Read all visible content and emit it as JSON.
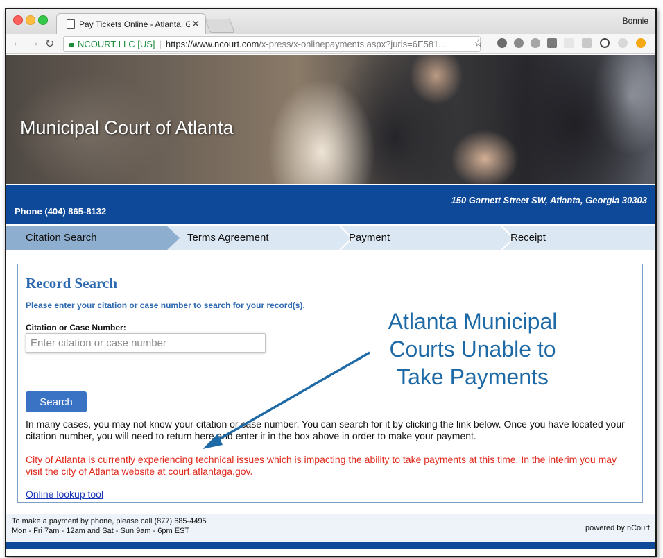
{
  "browser": {
    "tab_title": "Pay Tickets Online - Atlanta, G",
    "profile": "Bonnie",
    "cert_name": "NCOURT LLC [US]",
    "url_base": "https://www.ncourt.com",
    "url_path": "/x-press/x-onlinepayments.aspx?juris=6E581..."
  },
  "banner": {
    "title": "Municipal Court of Atlanta"
  },
  "header": {
    "phone": "Phone (404) 865-8132",
    "address": "150 Garnett Street SW, Atlanta, Georgia 30303"
  },
  "steps": [
    "Citation Search",
    "Terms Agreement",
    "Payment",
    "Receipt"
  ],
  "record": {
    "title": "Record Search",
    "instruction": "Please enter your citation or case number to search for your record(s).",
    "field_label": "Citation or Case Number:",
    "placeholder": "Enter citation or case number",
    "button": "Search",
    "info": "In many cases, you may not know your citation or case number. You can search for it by clicking the link below. Once you have located your citation number, you will need to return here and enter it in the box above in order to make your payment.",
    "alert": "City of Atlanta is currently experiencing technical issues which is impacting the ability to take payments at this time. In the interim you may visit the city of Atlanta website at court.atlantaga.gov.",
    "link": "Online lookup tool"
  },
  "annotation": {
    "line1": "Atlanta Municipal",
    "line2": "Courts Unable to",
    "line3": "Take Payments"
  },
  "footer": {
    "line1": "To make a payment by phone, please call (877) 685-4495",
    "line2": "Mon - Fri 7am - 12am and Sat - Sun 9am - 6pm EST",
    "powered": "powered by nCourt"
  },
  "colors": {
    "brand_blue": "#0d4899",
    "accent_blue": "#2e6ab1",
    "alert_red": "#e0281b",
    "annotation_blue": "#1e6aa6"
  }
}
